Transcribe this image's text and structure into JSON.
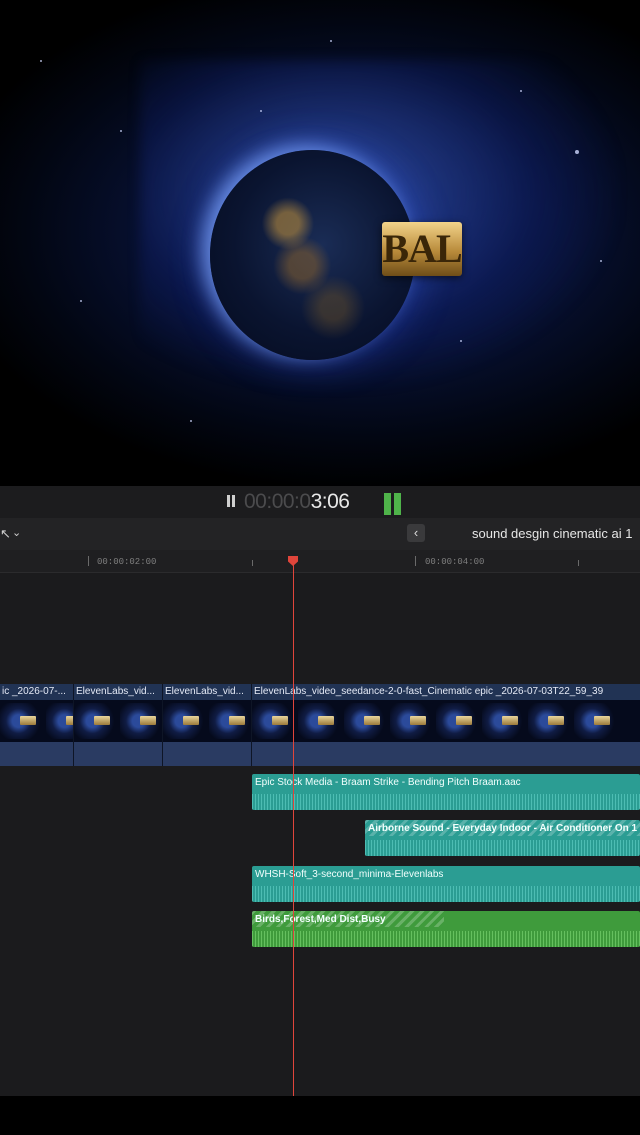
{
  "viewer": {
    "logo_text": "BAL"
  },
  "transport": {
    "timecode_dim": "00:00:0",
    "timecode_bright": "3:06"
  },
  "toolbar": {
    "tool_icon": "↖",
    "tool_chevron": "⌄",
    "back_icon": "‹",
    "project_name": "sound desgin cinematic ai 1"
  },
  "ruler": {
    "marks": [
      {
        "label": "00:00:02:00"
      },
      {
        "label": "00:00:04:00"
      }
    ]
  },
  "video_clips": [
    {
      "label": "ic _2026-07-..."
    },
    {
      "label": "ElevenLabs_vid..."
    },
    {
      "label": "ElevenLabs_vid..."
    },
    {
      "label": "ElevenLabs_video_seedance-2-0-fast_Cinematic epic _2026-07-03T22_59_39"
    }
  ],
  "audio_clips": [
    {
      "label": "Epic Stock Media - Braam Strike - Bending Pitch Braam.aac"
    },
    {
      "label": "Airborne Sound - Everyday Indoor - Air Conditioner On 1"
    },
    {
      "label": "WHSH-Soft_3-second_minima-Elevenlabs"
    },
    {
      "label": "Birds,Forest,Med Dist,Busy"
    }
  ],
  "colors": {
    "playhead": "#e0453b",
    "audio_teal": "#2b9d93",
    "audio_green": "#3f9b3c",
    "video_clip": "#213354",
    "meter_green": "#4fb34a"
  }
}
